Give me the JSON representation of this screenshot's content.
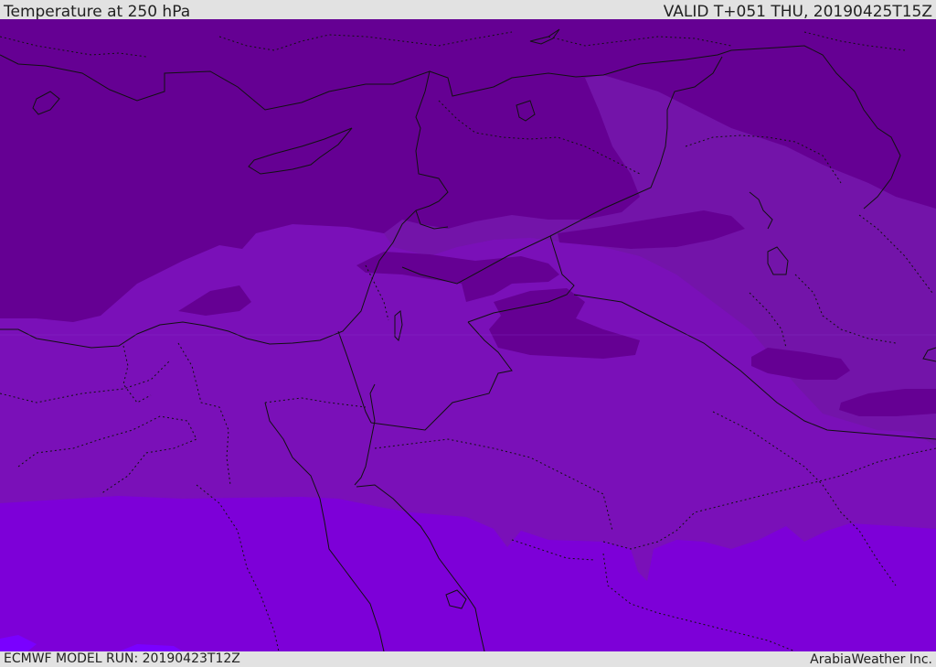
{
  "header": {
    "title": "Temperature at 250 hPa",
    "valid_time": "VALID T+051 THU, 20190425T15Z"
  },
  "footer": {
    "model_run": "ECMWF MODEL RUN: 20190423T12Z",
    "credit": "ArabiaWeather Inc."
  },
  "map": {
    "field": "temperature-250hpa",
    "colors": {
      "coldest": "#650093",
      "cold": "#7314a9",
      "mid": "#7a10b8",
      "warm": "#7d00d8",
      "warmest": "#7a00ff",
      "line": "#111111"
    }
  }
}
